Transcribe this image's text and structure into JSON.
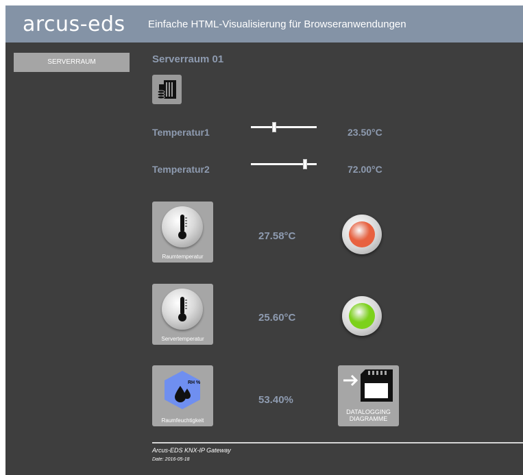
{
  "header": {
    "logo": "arcus-eds",
    "subtitle": "Einfache HTML-Visualisierung für Browseranwendungen"
  },
  "nav": {
    "items": [
      {
        "label": "SERVERRAUM"
      }
    ]
  },
  "room": {
    "title": "Serverraum 01",
    "icon": "server-rack-icon"
  },
  "controls": [
    {
      "label": "Temperatur1",
      "value": "23.50°C",
      "slider_fraction": 0.35
    },
    {
      "label": "Temperatur2",
      "value": "72.00°C",
      "slider_fraction": 0.82
    }
  ],
  "sensors": [
    {
      "tile_label": "Raumtemperatur",
      "icon": "thermometer-icon",
      "reading": "27.58°C",
      "status_color": "#e8613f"
    },
    {
      "tile_label": "Servertemperatur",
      "icon": "thermometer-icon",
      "reading": "25.60°C",
      "status_color": "#7cd11b"
    },
    {
      "tile_label": "Raumfeuchtigkeit",
      "icon": "humidity-icon",
      "icon_text": "RH %",
      "reading": "53.40%"
    }
  ],
  "datalogging": {
    "line1": "DATALOGGING",
    "line2": "DIAGRAMME",
    "icon": "sd-card-export-icon"
  },
  "footer": {
    "title": "Arcus-EDS KNX-IP Gateway",
    "date": "Date: 2016-05-18"
  },
  "colors": {
    "header_bg": "#8493a6",
    "page_bg": "#3e3e3e",
    "text_accent": "#8e9bb0"
  }
}
